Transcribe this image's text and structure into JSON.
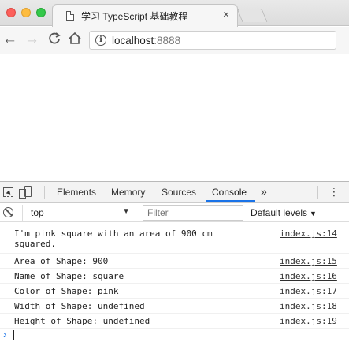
{
  "browser": {
    "tab_title": "学习 TypeScript 基础教程",
    "tab_close": "×",
    "url_host": "localhost",
    "url_port": ":8888",
    "nav": {
      "back": "←",
      "forward": "→",
      "reload": "C",
      "home": "⌂"
    },
    "info_icon": "i"
  },
  "devtools": {
    "tabs": [
      {
        "label": "Elements"
      },
      {
        "label": "Memory"
      },
      {
        "label": "Sources"
      },
      {
        "label": "Console"
      }
    ],
    "active_tab": "Console",
    "more_label": "»",
    "menu_label": "⋮",
    "context": "top",
    "context_arrow": "▼",
    "filter_placeholder": "Filter",
    "levels_label": "Default levels",
    "levels_arrow": "▼",
    "accent_color": "#1a73e8",
    "messages": [
      {
        "text": "I'm pink square with an area of 900 cm\nsquared.",
        "source": "index.js:14"
      },
      {
        "text": "Area of Shape: 900",
        "source": "index.js:15"
      },
      {
        "text": "Name of Shape: square",
        "source": "index.js:16"
      },
      {
        "text": "Color of Shape: pink",
        "source": "index.js:17"
      },
      {
        "text": "Width of Shape: undefined",
        "source": "index.js:18"
      },
      {
        "text": "Height of Shape: undefined",
        "source": "index.js:19"
      }
    ],
    "prompt_symbol": "›"
  }
}
